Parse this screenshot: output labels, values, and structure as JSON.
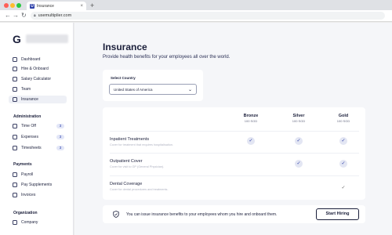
{
  "browser": {
    "tab_title": "Insurance",
    "tab_favicon": "U",
    "tab_close": "×",
    "new_tab": "+",
    "url": "usemultiplier.com"
  },
  "sidebar": {
    "logo": "G",
    "primary_items": [
      {
        "label": "Dashboard",
        "icon": "dashboard-icon"
      },
      {
        "label": "Hire & Onboard",
        "icon": "hire-icon"
      },
      {
        "label": "Salary Calculator",
        "icon": "calculator-icon"
      },
      {
        "label": "Team",
        "icon": "team-icon"
      },
      {
        "label": "Insurance",
        "icon": "shield-icon",
        "active": true
      }
    ],
    "administration": {
      "title": "Administration",
      "items": [
        {
          "label": "Time Off",
          "count": "3"
        },
        {
          "label": "Expenses",
          "count": "3"
        },
        {
          "label": "Timesheets",
          "count": "3"
        }
      ]
    },
    "payments": {
      "title": "Payments",
      "items": [
        {
          "label": "Payroll"
        },
        {
          "label": "Pay Supplements"
        },
        {
          "label": "Invoices"
        }
      ]
    },
    "organization": {
      "title": "Organization",
      "items": [
        {
          "label": "Company"
        }
      ]
    }
  },
  "main": {
    "title": "Insurance",
    "subtitle": "Provide health benefits for your employees all over the world.",
    "country": {
      "label": "Select Country",
      "value": "United States of America"
    },
    "plans": [
      {
        "name": "Bronze",
        "price": "100 SGD"
      },
      {
        "name": "Silver",
        "price": "100 SGD"
      },
      {
        "name": "Gold",
        "price": "100 SGD"
      }
    ],
    "coverage_rows": [
      {
        "title": "Inpatient Treatments",
        "description": "Cover for treatment that requires hospitalisation.",
        "included": [
          true,
          true,
          true
        ]
      },
      {
        "title": "Outpatient Cover",
        "description": "Cover for visit to GP (General Physician).",
        "included": [
          false,
          true,
          true
        ]
      },
      {
        "title": "Dental Coverage",
        "description": "Cover for dental procedures and treatments.",
        "included": [
          false,
          false,
          true
        ]
      }
    ],
    "check_glyph": "✓",
    "banner": {
      "text": "You can issue insurance benefits to your employees whom you hire and onboard them.",
      "button": "Start Hiring"
    }
  },
  "colors": {
    "accent": "#2b3ea8",
    "text": "#1b1f3b",
    "check_bg": "#e3e6f3"
  }
}
